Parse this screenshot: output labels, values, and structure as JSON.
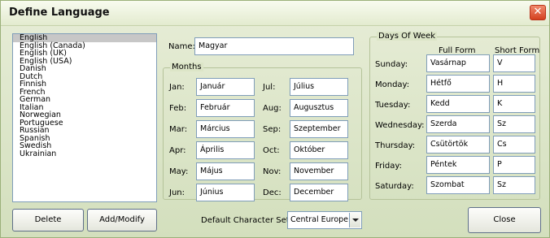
{
  "window": {
    "title": "Define Language",
    "close_glyph": "✕"
  },
  "languages": [
    "English",
    "English (Canada)",
    "English (UK)",
    "English (USA)",
    "Danish",
    "Dutch",
    "Finnish",
    "French",
    "German",
    "Italian",
    "Norwegian",
    "Portuguese",
    "Russian",
    "Spanish",
    "Swedish",
    "Ukrainian"
  ],
  "selected_language": "English",
  "name": {
    "label": "Name:",
    "value": "Magyar"
  },
  "months": {
    "title": "Months",
    "left": [
      {
        "label": "Jan:",
        "value": "Január"
      },
      {
        "label": "Feb:",
        "value": "Február"
      },
      {
        "label": "Mar:",
        "value": "Március"
      },
      {
        "label": "Apr:",
        "value": "Április"
      },
      {
        "label": "May:",
        "value": "Május"
      },
      {
        "label": "Jun:",
        "value": "Június"
      }
    ],
    "right": [
      {
        "label": "Jul:",
        "value": "Július"
      },
      {
        "label": "Aug:",
        "value": "Augusztus"
      },
      {
        "label": "Sep:",
        "value": "Szeptember"
      },
      {
        "label": "Oct:",
        "value": "Október"
      },
      {
        "label": "Nov:",
        "value": "November"
      },
      {
        "label": "Dec:",
        "value": "December"
      }
    ]
  },
  "days": {
    "title": "Days Of Week",
    "full_header": "Full Form",
    "short_header": "Short Form",
    "rows": [
      {
        "label": "Sunday:",
        "full": "Vasárnap",
        "short": "V"
      },
      {
        "label": "Monday:",
        "full": "Hétfő",
        "short": "H"
      },
      {
        "label": "Tuesday:",
        "full": "Kedd",
        "short": "K"
      },
      {
        "label": "Wednesday:",
        "full": "Szerda",
        "short": "Sz"
      },
      {
        "label": "Thursday:",
        "full": "Csütörtök",
        "short": "Cs"
      },
      {
        "label": "Friday:",
        "full": "Péntek",
        "short": "P"
      },
      {
        "label": "Saturday:",
        "full": "Szombat",
        "short": "Sz"
      }
    ]
  },
  "buttons": {
    "delete": "Delete",
    "add_modify": "Add/Modify",
    "close": "Close"
  },
  "charset": {
    "label": "Default Character Set:",
    "value": "Central Europe"
  },
  "colors": {
    "accent_close": "#d4401f",
    "selection": "#c7c7c7",
    "window_bg": "#d9e3c8"
  }
}
